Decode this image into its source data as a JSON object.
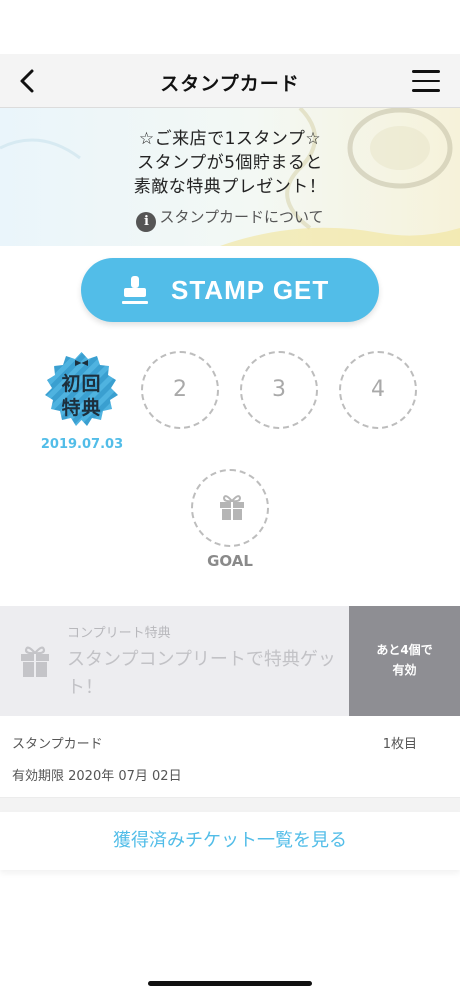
{
  "nav": {
    "title": "スタンプカード"
  },
  "banner": {
    "line1": "☆ご来店で1スタンプ☆",
    "line2": "スタンプが5個貯まると",
    "line3": "素敵な特典プレゼント！",
    "about": "スタンプカードについて"
  },
  "stamp_button": {
    "label": "STAMP GET"
  },
  "stamps": {
    "first": {
      "line1": "初回",
      "line2": "特典",
      "date": "2019.07.03"
    },
    "slot2": "2",
    "slot3": "3",
    "slot4": "4",
    "goal_label": "GOAL"
  },
  "complete": {
    "small": "コンプリート特典",
    "title": "スタンプコンプリートで特典ゲット！",
    "remain_line1": "あと4個で",
    "remain_line2": "有効"
  },
  "card": {
    "name": "スタンプカード",
    "count": "1枚目",
    "expiry": "有効期限 2020年 07月 02日"
  },
  "tickets_link": "獲得済みチケット一覧を見る",
  "colors": {
    "accent": "#52bde8",
    "remain_bg": "#8e8e93"
  }
}
